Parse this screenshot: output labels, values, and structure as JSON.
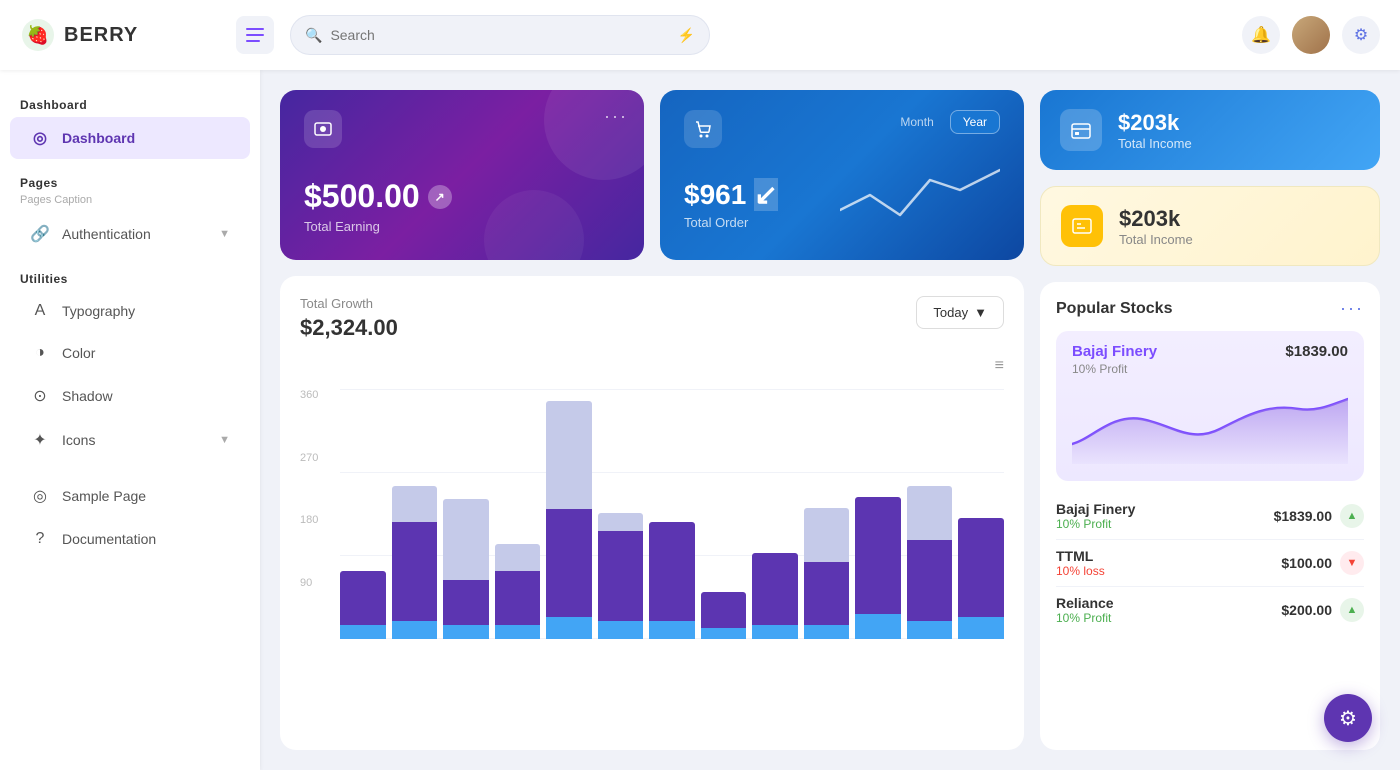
{
  "app": {
    "name": "BERRY",
    "logo_alt": "Berry Logo"
  },
  "topbar": {
    "hamburger_label": "☰",
    "search_placeholder": "Search",
    "notification_icon": "🔔",
    "gear_icon": "⚙"
  },
  "sidebar": {
    "section_dashboard": "Dashboard",
    "active_item": "Dashboard",
    "section_pages": "Pages",
    "pages_caption": "Pages Caption",
    "auth_label": "Authentication",
    "section_utilities": "Utilities",
    "typography_label": "Typography",
    "color_label": "Color",
    "shadow_label": "Shadow",
    "icons_label": "Icons",
    "sample_page_label": "Sample Page",
    "documentation_label": "Documentation"
  },
  "cards": {
    "earning": {
      "amount": "$500.00",
      "label": "Total Earning",
      "dots": "···"
    },
    "order": {
      "amount": "$961",
      "label": "Total Order",
      "toggle_month": "Month",
      "toggle_year": "Year"
    },
    "income_blue": {
      "amount": "$203k",
      "label": "Total Income"
    },
    "income_yellow": {
      "amount": "$203k",
      "label": "Total Income"
    }
  },
  "chart": {
    "title": "Total Growth",
    "amount": "$2,324.00",
    "today_btn": "Today",
    "y_labels": [
      "360",
      "270",
      "180",
      "90"
    ],
    "bars": [
      {
        "purple": 30,
        "blue": 8,
        "light": 0
      },
      {
        "purple": 55,
        "blue": 10,
        "light": 20
      },
      {
        "purple": 25,
        "blue": 8,
        "light": 45
      },
      {
        "purple": 30,
        "blue": 8,
        "light": 15
      },
      {
        "purple": 60,
        "blue": 12,
        "light": 60
      },
      {
        "purple": 50,
        "blue": 10,
        "light": 10
      },
      {
        "purple": 55,
        "blue": 10,
        "light": 0
      },
      {
        "purple": 20,
        "blue": 6,
        "light": 0
      },
      {
        "purple": 40,
        "blue": 8,
        "light": 0
      },
      {
        "purple": 35,
        "blue": 8,
        "light": 30
      },
      {
        "purple": 65,
        "blue": 14,
        "light": 0
      },
      {
        "purple": 45,
        "blue": 10,
        "light": 30
      },
      {
        "purple": 55,
        "blue": 12,
        "light": 0
      }
    ]
  },
  "stocks": {
    "title": "Popular Stocks",
    "more_icon": "···",
    "featured": {
      "name": "Bajaj Finery",
      "price": "$1839.00",
      "profit": "10% Profit"
    },
    "list": [
      {
        "name": "Bajaj Finery",
        "price": "$1839.00",
        "change": "10% Profit",
        "trend": "up"
      },
      {
        "name": "TTML",
        "price": "$100.00",
        "change": "10% loss",
        "trend": "down"
      },
      {
        "name": "Reliance",
        "price": "$200.00",
        "change": "10% Profit",
        "trend": "up"
      }
    ]
  },
  "fab": {
    "icon": "⚙"
  }
}
